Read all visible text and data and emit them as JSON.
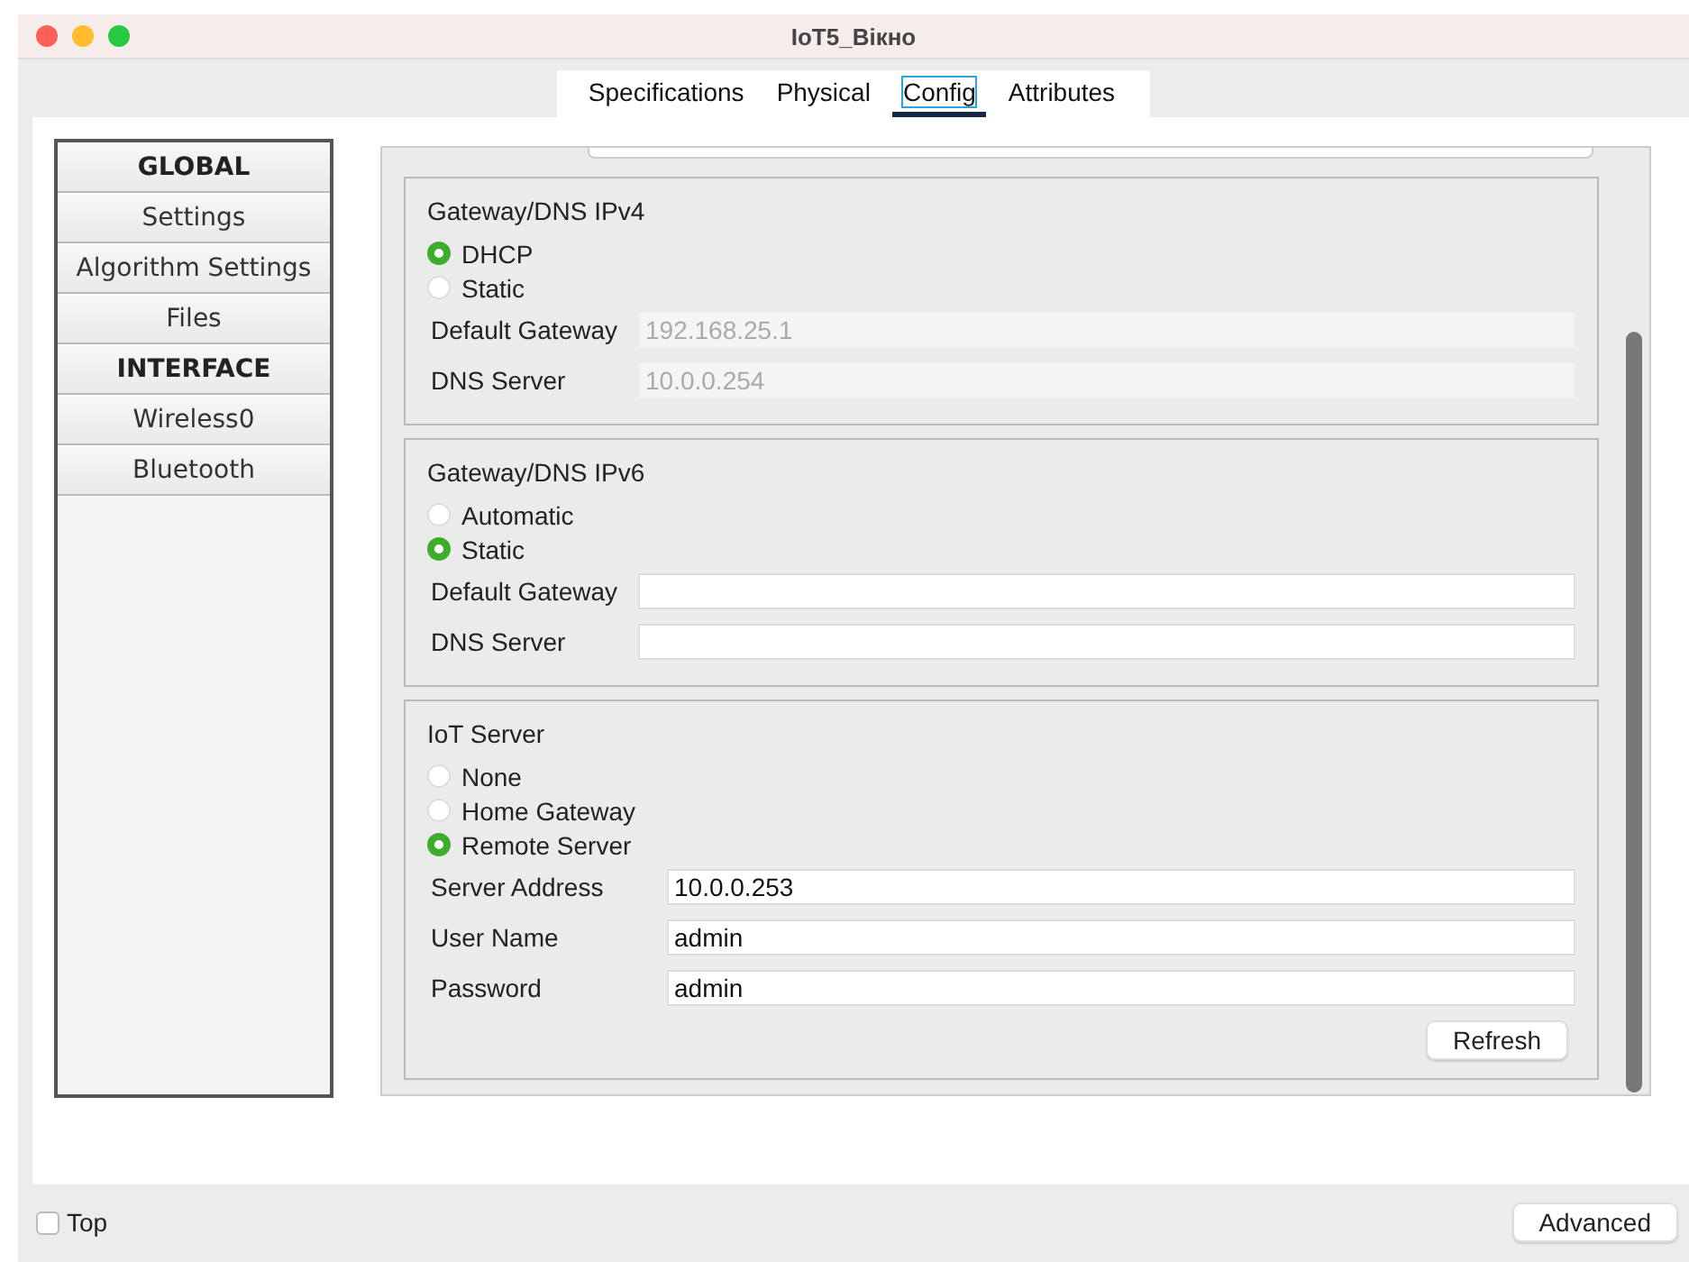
{
  "window": {
    "title": "IoT5_Вікно"
  },
  "tabs": [
    {
      "label": "Specifications",
      "selected": false
    },
    {
      "label": "Physical",
      "selected": false
    },
    {
      "label": "Config",
      "selected": true
    },
    {
      "label": "Attributes",
      "selected": false
    }
  ],
  "sidebar": {
    "items": [
      {
        "label": "GLOBAL",
        "kind": "header"
      },
      {
        "label": "Settings",
        "kind": "item"
      },
      {
        "label": "Algorithm Settings",
        "kind": "item"
      },
      {
        "label": "Files",
        "kind": "item"
      },
      {
        "label": "INTERFACE",
        "kind": "header"
      },
      {
        "label": "Wireless0",
        "kind": "item"
      },
      {
        "label": "Bluetooth",
        "kind": "item"
      }
    ]
  },
  "sections": [
    {
      "title": "Gateway/DNS IPv4",
      "radios": [
        {
          "label": "DHCP",
          "selected": true
        },
        {
          "label": "Static",
          "selected": false
        }
      ],
      "fields": [
        {
          "label": "Default Gateway",
          "value": "192.168.25.1",
          "disabled": true
        },
        {
          "label": "DNS Server",
          "value": "10.0.0.254",
          "disabled": true
        }
      ]
    },
    {
      "title": "Gateway/DNS IPv6",
      "radios": [
        {
          "label": "Automatic",
          "selected": false
        },
        {
          "label": "Static",
          "selected": true
        }
      ],
      "fields": [
        {
          "label": "Default Gateway",
          "disabled": false
        },
        {
          "label": "DNS Server",
          "disabled": false
        }
      ]
    },
    {
      "title": "IoT Server",
      "radios": [
        {
          "label": "None",
          "selected": false
        },
        {
          "label": "Home Gateway",
          "selected": false
        },
        {
          "label": "Remote Server",
          "selected": true
        }
      ],
      "fields": [
        {
          "label": "Server Address",
          "value": "10.0.0.253",
          "disabled": false
        },
        {
          "label": "User Name",
          "value": "admin",
          "disabled": false
        },
        {
          "label": "Password",
          "value": "admin",
          "disabled": false
        }
      ],
      "button": "Refresh"
    }
  ],
  "footer": {
    "top_checkbox": {
      "label": "Top",
      "checked": false
    },
    "button": "Advanced"
  }
}
